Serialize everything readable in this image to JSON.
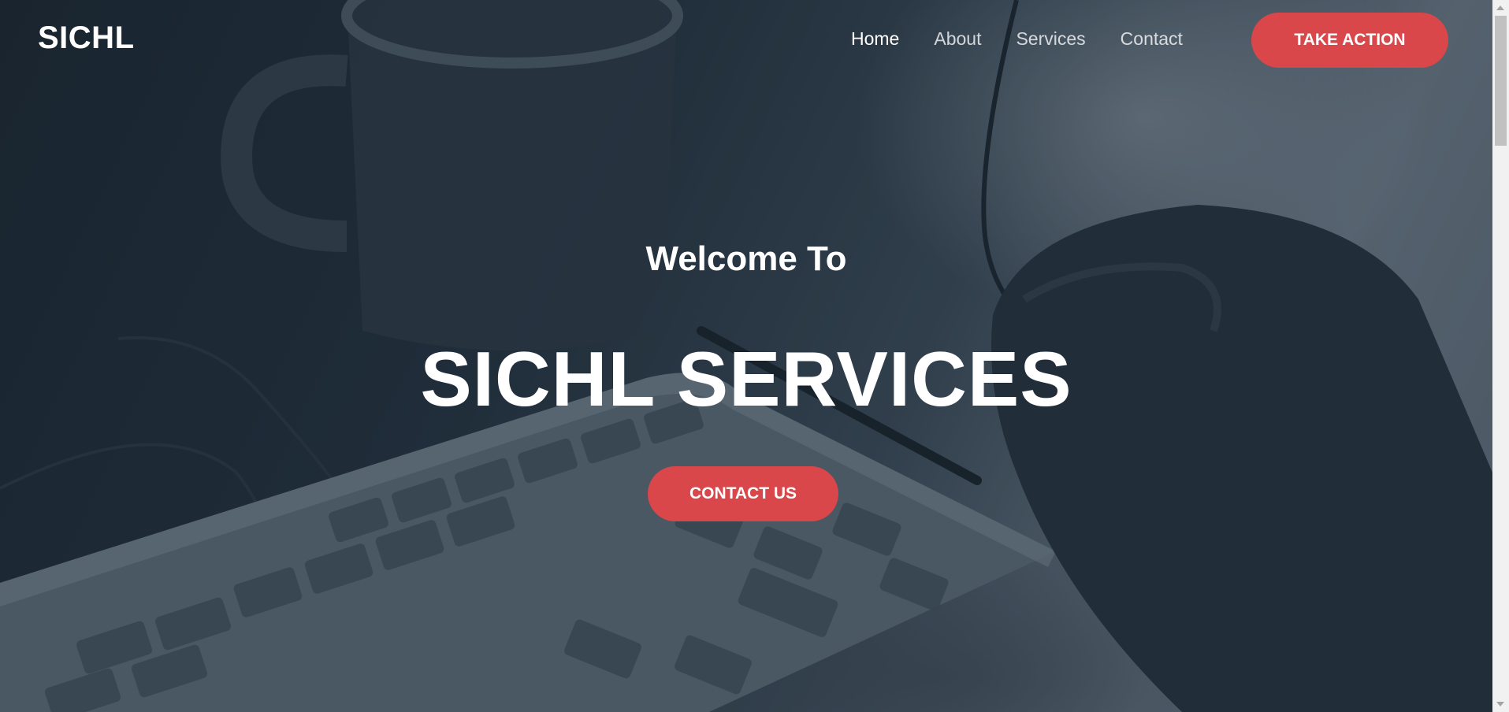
{
  "header": {
    "brand": "SICHL",
    "nav": [
      {
        "label": "Home",
        "active": true
      },
      {
        "label": "About",
        "active": false
      },
      {
        "label": "Services",
        "active": false
      },
      {
        "label": "Contact",
        "active": false
      }
    ],
    "cta_label": "TAKE ACTION"
  },
  "hero": {
    "welcome": "Welcome To",
    "headline": "SICHL SERVICES",
    "button_label": "CONTACT US"
  },
  "colors": {
    "accent": "#d9474a",
    "text": "#ffffff"
  }
}
